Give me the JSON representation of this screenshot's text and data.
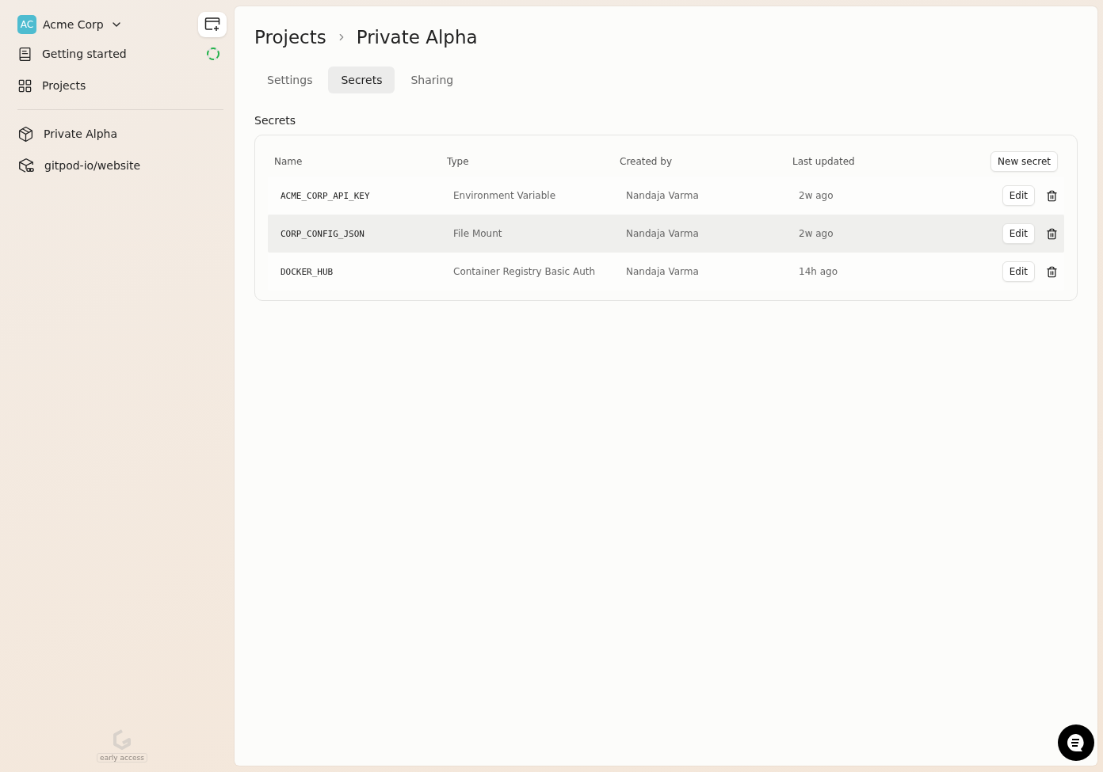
{
  "org": {
    "initials": "AC",
    "name": "Acme Corp"
  },
  "nav": [
    {
      "label": "Getting started",
      "kind": "guide"
    },
    {
      "label": "Projects",
      "kind": "grid"
    }
  ],
  "projects": [
    {
      "label": "Private Alpha",
      "kind": "project"
    },
    {
      "label": "gitpod-io/website",
      "kind": "repo"
    }
  ],
  "badge": "early access",
  "breadcrumb": [
    "Projects",
    "Private Alpha"
  ],
  "tabs": [
    {
      "label": "Settings",
      "selected": false
    },
    {
      "label": "Secrets",
      "selected": true
    },
    {
      "label": "Sharing",
      "selected": false
    }
  ],
  "section_title": "Secrets",
  "table": {
    "columns": [
      "Name",
      "Type",
      "Created by",
      "Last updated"
    ],
    "action": "New secret",
    "rows": [
      {
        "name": "ACME_CORP_API_KEY",
        "type": "Environment Variable",
        "created_by": "Nandaja Varma",
        "updated": "2w ago",
        "edit": "Edit",
        "highlighted": false
      },
      {
        "name": "CORP_CONFIG_JSON",
        "type": "File Mount",
        "created_by": "Nandaja Varma",
        "updated": "2w ago",
        "edit": "Edit",
        "highlighted": true
      },
      {
        "name": "DOCKER_HUB",
        "type": "Container Registry Basic Auth",
        "created_by": "Nandaja Varma",
        "updated": "14h ago",
        "edit": "Edit",
        "highlighted": false
      }
    ]
  }
}
